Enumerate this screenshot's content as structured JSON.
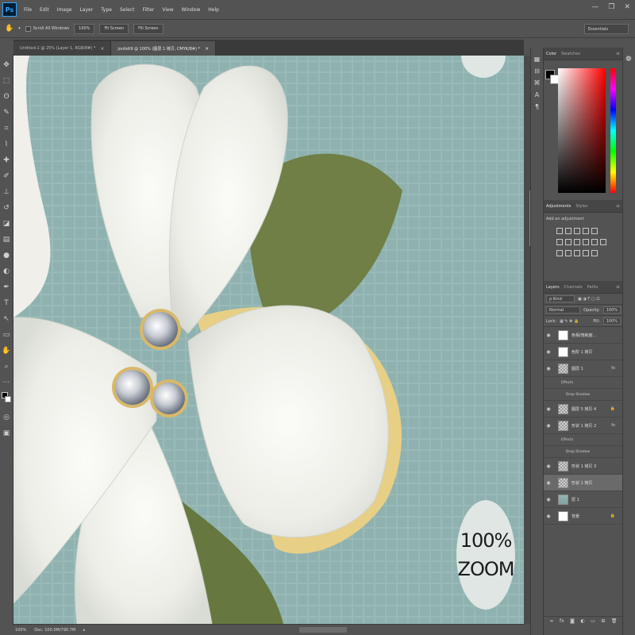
{
  "app": {
    "logo": "Ps",
    "menu": [
      "File",
      "Edit",
      "Image",
      "Layer",
      "Type",
      "Select",
      "Filter",
      "View",
      "Window",
      "Help"
    ],
    "window_controls": [
      "—",
      "❐",
      "✕"
    ]
  },
  "options": {
    "scroll_all_windows": "Scroll All Windows",
    "zoom_value": "100%",
    "fit_screen": "Fit Screen",
    "fill_screen": "Fill Screen",
    "workspace": "Essentials"
  },
  "tabs": [
    {
      "label": "Untitled-1 @ 25% (Layer 1, RGB/8#) *",
      "close": "×"
    },
    {
      "label": "jonfelt9 @ 100% (图层 1 拷贝, CMYK/8#) *",
      "close": "×"
    }
  ],
  "canvas": {
    "zoom_line1": "100%",
    "zoom_line2": "ZOOM",
    "colors": {
      "background": "#8fb2b0",
      "petal": "#f2f1ec",
      "leaf": "#6f7f45",
      "gold": "#e8cf86"
    }
  },
  "status": {
    "zoom": "100%",
    "doc": "Doc: 100.0M/790.7M"
  },
  "panels": {
    "color_tabs": [
      "Color",
      "Swatches"
    ],
    "adjust_tabs": [
      "Adjustments",
      "Styles"
    ],
    "add_adjustment": "Add an adjustment",
    "layers_tabs": [
      "Layers",
      "Channels",
      "Paths"
    ],
    "kind": "ρ Kind",
    "blend": "Normal",
    "opacity_label": "Opacity:",
    "opacity": "100%",
    "lock_label": "Lock:",
    "fill_label": "Fill:",
    "fill": "100%",
    "layers": [
      {
        "name": "色相/饱和度...",
        "thumb": "white",
        "fx": "",
        "lock": ""
      },
      {
        "name": "色阶 1 拷贝",
        "thumb": "white",
        "fx": "",
        "lock": ""
      },
      {
        "name": "图层 1",
        "thumb": "checker",
        "fx": "fx",
        "lock": ""
      },
      {
        "effects": "Effects"
      },
      {
        "effects_sub": "Drop Shadow"
      },
      {
        "name": "图层 5 拷贝 4",
        "thumb": "checker",
        "fx": "",
        "lock": "🔒"
      },
      {
        "name": "形状 1 拷贝 2",
        "thumb": "checker",
        "fx": "fx",
        "lock": ""
      },
      {
        "effects": "Effects"
      },
      {
        "effects_sub": "Drop Shadow"
      },
      {
        "name": "形状 1 拷贝 3",
        "thumb": "checker",
        "fx": "",
        "lock": ""
      },
      {
        "name": "形状 1 拷贝",
        "thumb": "checker",
        "fx": "",
        "lock": "",
        "selected": true
      },
      {
        "name": "层 1",
        "thumb": "teal",
        "fx": "",
        "lock": ""
      },
      {
        "name": "背景",
        "thumb": "white",
        "fx": "",
        "lock": "🔒"
      }
    ],
    "footer_icons": [
      "link-icon",
      "fx-icon",
      "mask-icon",
      "adjustment-icon",
      "folder-icon",
      "new-layer-icon",
      "trash-icon"
    ]
  }
}
